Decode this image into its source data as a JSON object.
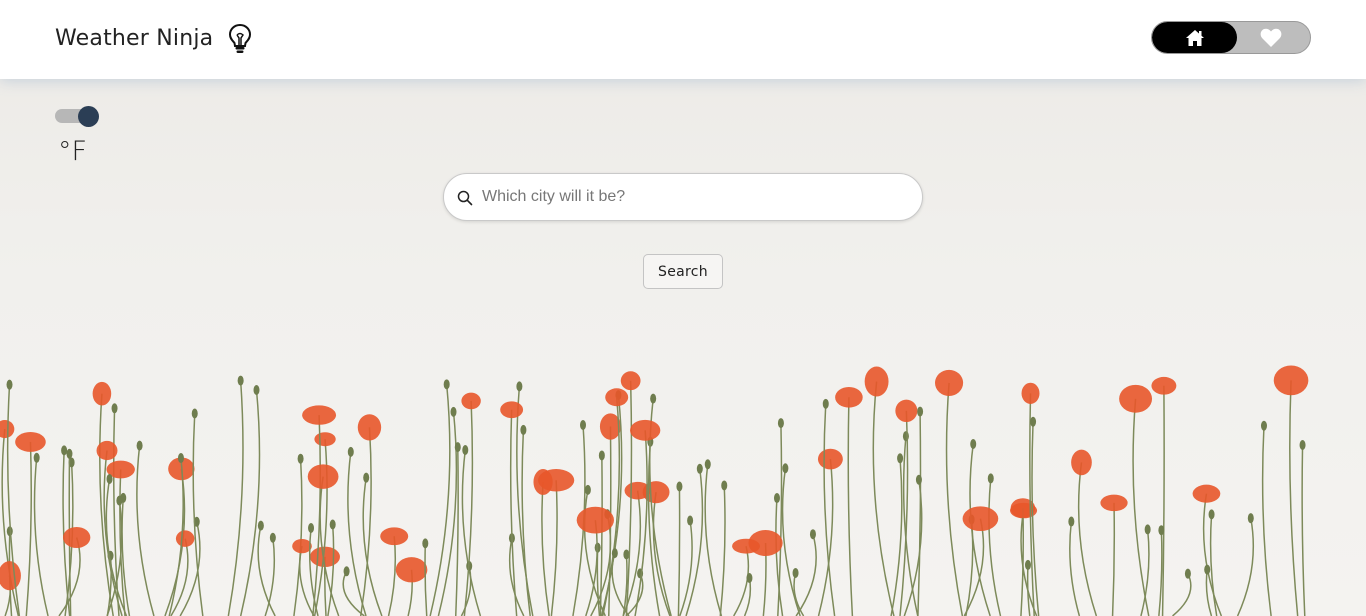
{
  "header": {
    "title": "Weather Ninja",
    "logo_icon": "lightbulb-icon",
    "nav": {
      "home_icon": "home-icon",
      "favorites_icon": "heart-icon",
      "active": "home"
    }
  },
  "units": {
    "toggle_on": true,
    "label": "°F"
  },
  "search": {
    "icon": "search-icon",
    "placeholder": "Which city will it be?",
    "value": "",
    "button_label": "Search"
  },
  "background": {
    "description_icon": "poppy-field-image"
  },
  "colors": {
    "nav_active": "#000000",
    "nav_inactive": "#bdbdbd",
    "toggle_knob": "#2b3e55",
    "poppy": "#e8562a"
  }
}
